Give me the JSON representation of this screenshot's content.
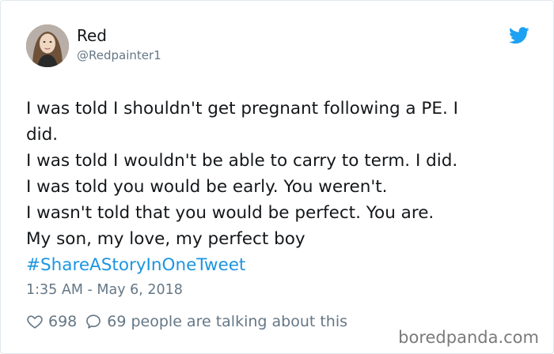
{
  "user": {
    "display_name": "Red",
    "handle": "@Redpainter1"
  },
  "tweet": {
    "lines": [
      "I was told I shouldn't get pregnant following a PE. I",
      "did.",
      "I was told I wouldn't be able to carry to term. I did.",
      "I was told you would be early. You weren't.",
      "I wasn't told that you would be perfect. You are.",
      "My son, my love, my perfect boy"
    ],
    "hashtag": "#ShareAStoryInOneTweet",
    "timestamp": "1:35 AM - May 6, 2018"
  },
  "actions": {
    "likes": "698",
    "replies": "69 people are talking about this"
  },
  "watermark": "boredpanda.com",
  "colors": {
    "link": "#1b95e0",
    "secondary_text": "#657786",
    "bird": "#1da1f2"
  },
  "icons": {
    "bird": "twitter-bird-icon",
    "heart": "heart-icon",
    "reply": "reply-bubble-icon"
  }
}
